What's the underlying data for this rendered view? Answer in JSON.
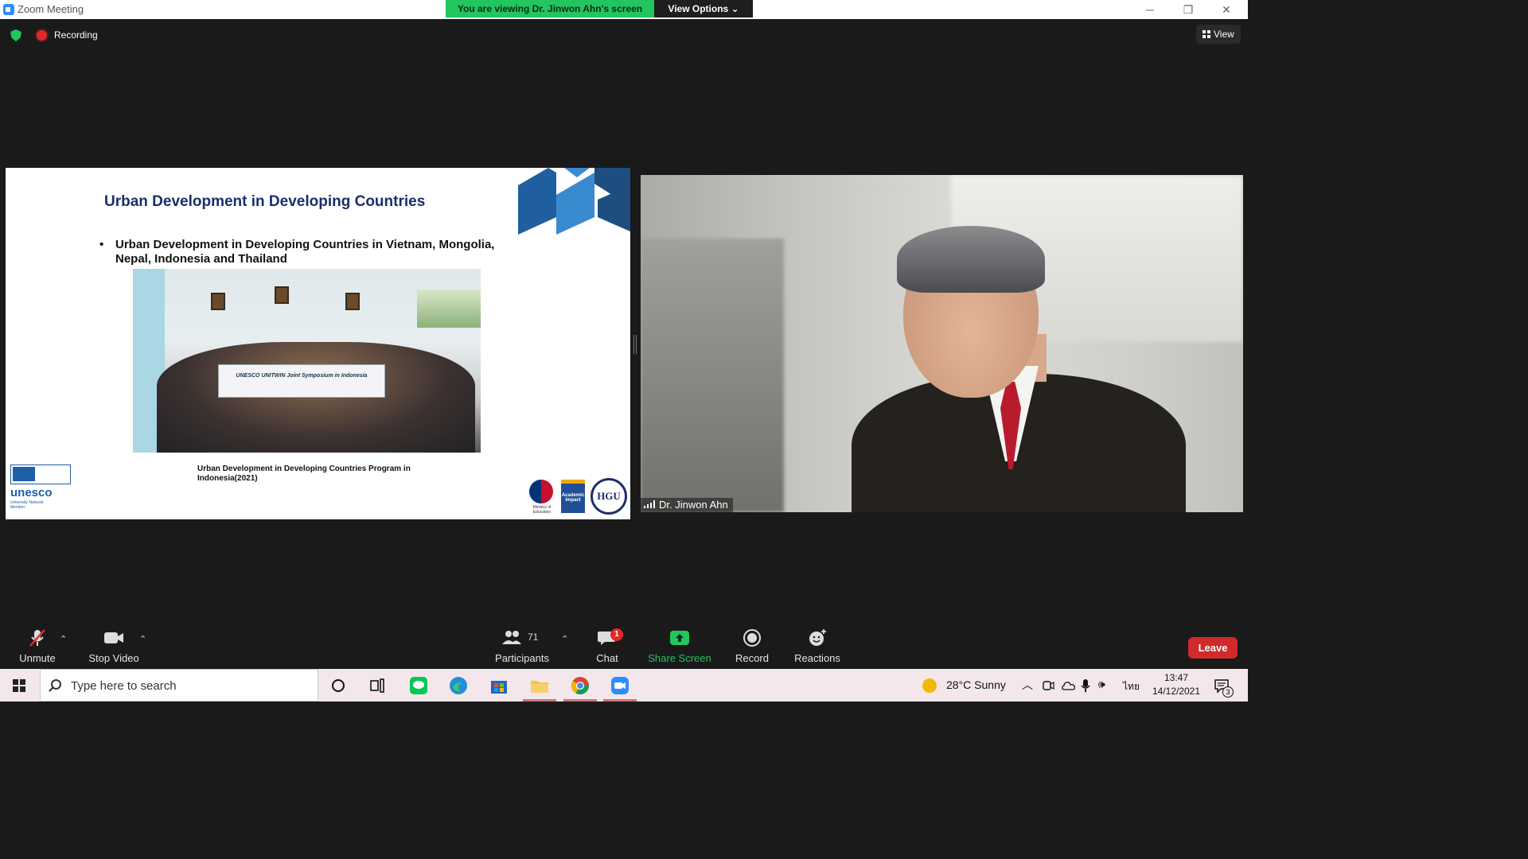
{
  "window": {
    "title": "Zoom Meeting",
    "viewing_banner": "You are viewing Dr. Jinwon Ahn's screen",
    "view_options": "View Options ⌄",
    "controls": {
      "minimize": "─",
      "restore": "❐",
      "close": "✕"
    }
  },
  "top_bar": {
    "recording_label": "Recording",
    "view_label": "View"
  },
  "slide": {
    "title": "Urban Development in Developing Countries",
    "bullet": "Urban Development in Developing Countries in Vietnam, Mongolia, Nepal, Indonesia and Thailand",
    "photo_banner": "UNESCO UNITWIN Joint Symposium in Indonesia",
    "caption_line1": "Urban Development in Developing Countries Program in",
    "caption_line2": "Indonesia(2021)",
    "unesco_word": "unesco",
    "unesco_sub": "University Network Member",
    "moe_label": "Ministry of Education",
    "impact_label": "Academic Impact",
    "hgu_label": "HGU"
  },
  "participant_video": {
    "name": "Dr. Jinwon Ahn"
  },
  "control_bar": {
    "unmute": "Unmute",
    "stop_video": "Stop Video",
    "participants_label": "Participants",
    "participants_count": "71",
    "chat_label": "Chat",
    "chat_badge": "1",
    "share_screen": "Share Screen",
    "record": "Record",
    "reactions": "Reactions",
    "leave": "Leave"
  },
  "taskbar": {
    "search_placeholder": "Type here to search",
    "weather": "28°C  Sunny",
    "language": "ไทย",
    "time": "13:47",
    "date": "14/12/2021",
    "notifications": "3"
  },
  "colors": {
    "share_green": "#22c55e",
    "leave_red": "#d02a2a",
    "slide_title_navy": "#1a2e6b"
  }
}
